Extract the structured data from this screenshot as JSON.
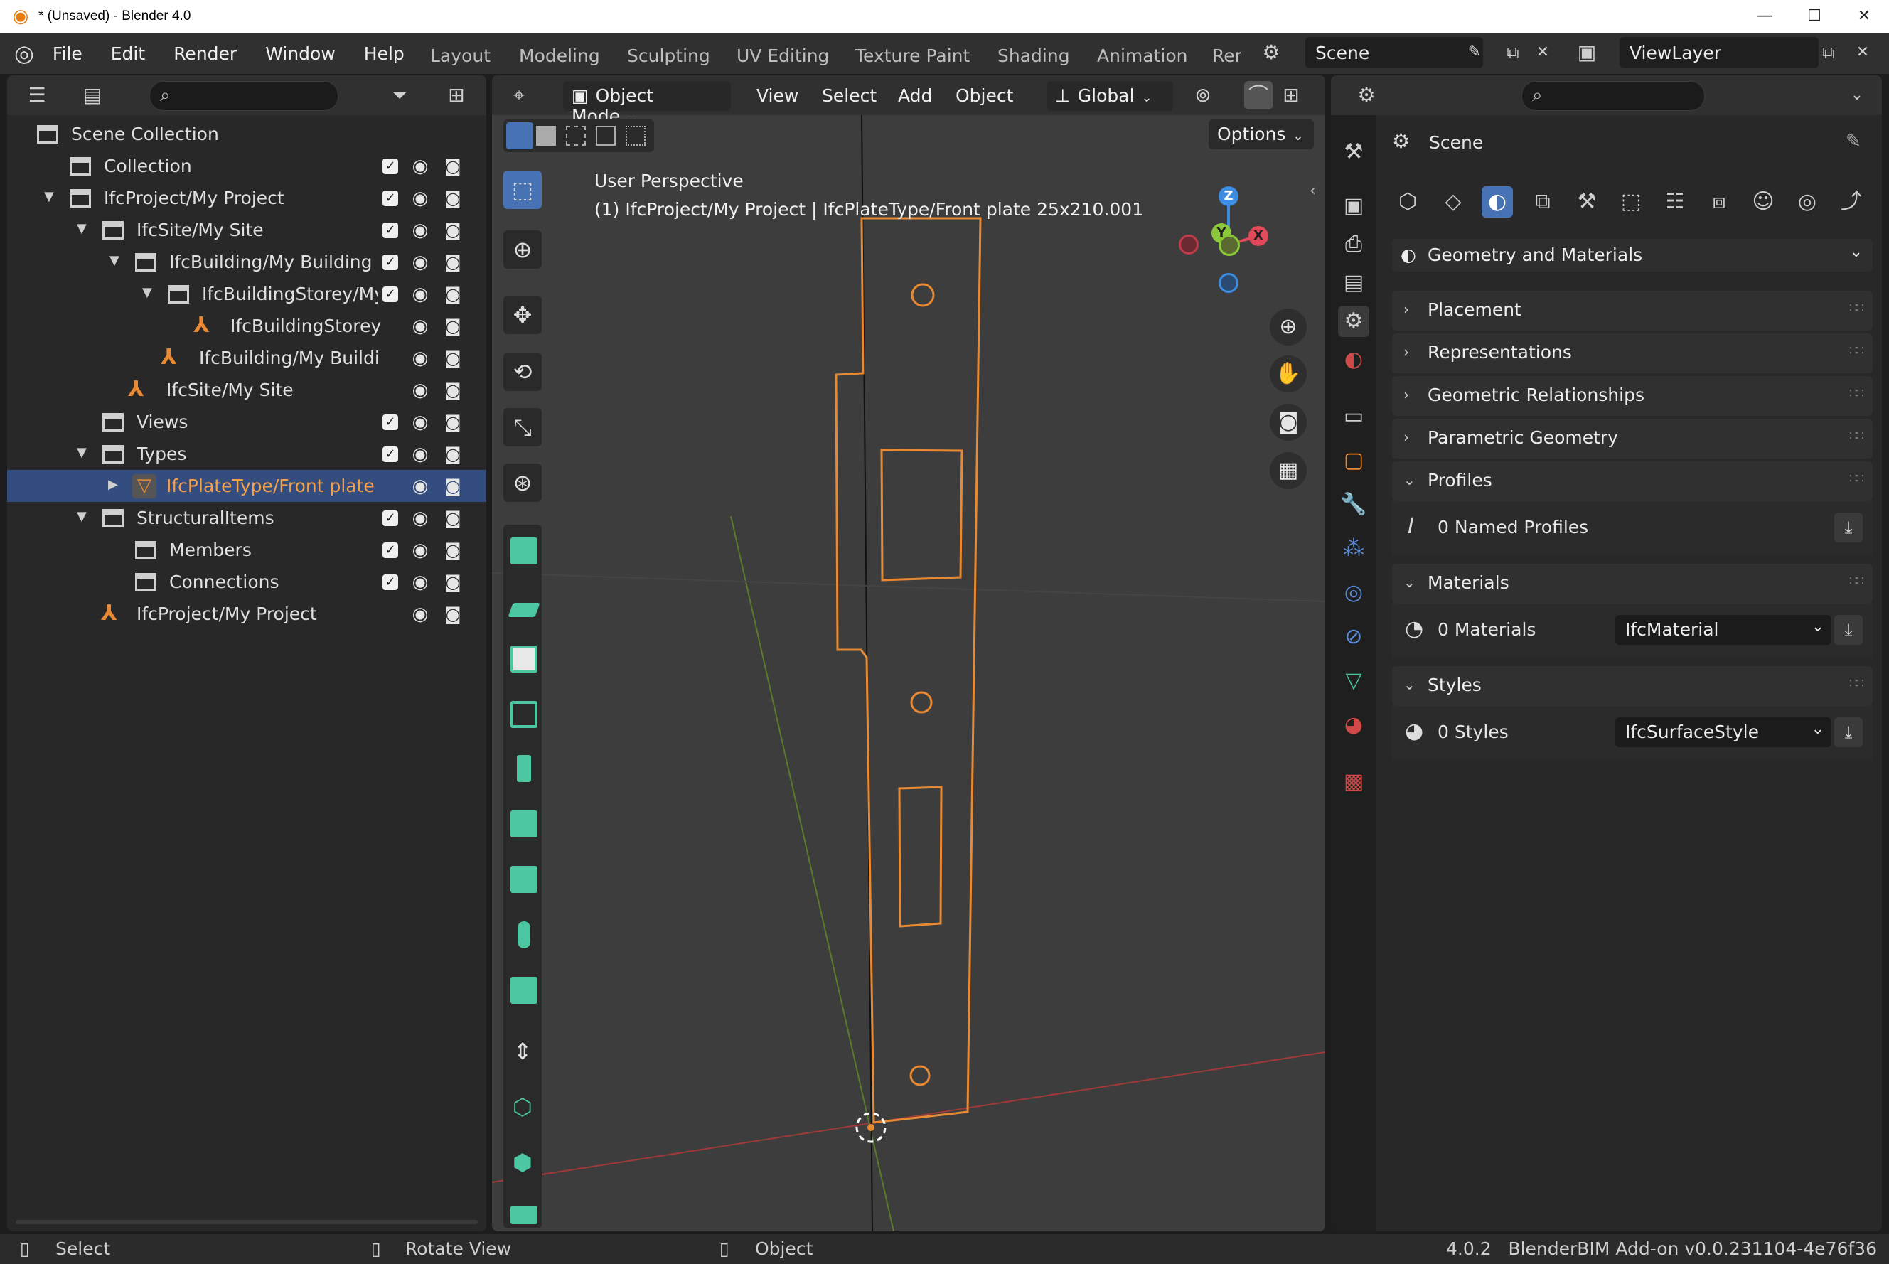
{
  "window": {
    "title": "* (Unsaved) - Blender 4.0"
  },
  "menu": [
    "File",
    "Edit",
    "Render",
    "Window",
    "Help"
  ],
  "workspaces": [
    "Layout",
    "Modeling",
    "Sculpting",
    "UV Editing",
    "Texture Paint",
    "Shading",
    "Animation",
    "Ren"
  ],
  "scene_field": "Scene",
  "viewlayer_field": "ViewLayer",
  "outliner": {
    "rows": [
      {
        "label": "Scene Collection"
      },
      {
        "label": "Collection"
      },
      {
        "label": "IfcProject/My Project"
      },
      {
        "label": "IfcSite/My Site"
      },
      {
        "label": "IfcBuilding/My Building"
      },
      {
        "label": "IfcBuildingStorey/My"
      },
      {
        "label": "IfcBuildingStorey"
      },
      {
        "label": "IfcBuilding/My Buildi"
      },
      {
        "label": "IfcSite/My Site"
      },
      {
        "label": "Views"
      },
      {
        "label": "Types"
      },
      {
        "label": "IfcPlateType/Front plate"
      },
      {
        "label": "StructuralItems"
      },
      {
        "label": "Members"
      },
      {
        "label": "Connections"
      },
      {
        "label": "IfcProject/My Project"
      }
    ]
  },
  "viewport": {
    "mode": "Object Mode",
    "menus": [
      "View",
      "Select",
      "Add",
      "Object"
    ],
    "transform": "Global",
    "options_label": "Options",
    "overlay_line1": "User Perspective",
    "overlay_line2": "(1) IfcProject/My Project | IfcPlateType/Front plate 25x210.001",
    "gizmo": {
      "z": "Z",
      "y": "Y",
      "x": "X"
    }
  },
  "properties": {
    "scene_label": "Scene",
    "geometry_dropdown": "Geometry and Materials",
    "panels": [
      "Placement",
      "Representations",
      "Geometric Relationships",
      "Parametric Geometry",
      "Profiles",
      "Materials",
      "Styles"
    ],
    "profiles_row": "0 Named Profiles",
    "materials_row": "0 Materials",
    "materials_combo": "IfcMaterial",
    "styles_row": "0 Styles",
    "styles_combo": "IfcSurfaceStyle"
  },
  "statusbar": {
    "select": "Select",
    "rotate": "Rotate View",
    "object": "Object",
    "version": "4.0.2   BlenderBIM Add-on v0.0.231104-4e76f36"
  },
  "colors": {
    "accent": "#4772b3",
    "selected_row": "#334d80",
    "orange": "#e88a33",
    "ifc_green": "#4cc7a2"
  }
}
